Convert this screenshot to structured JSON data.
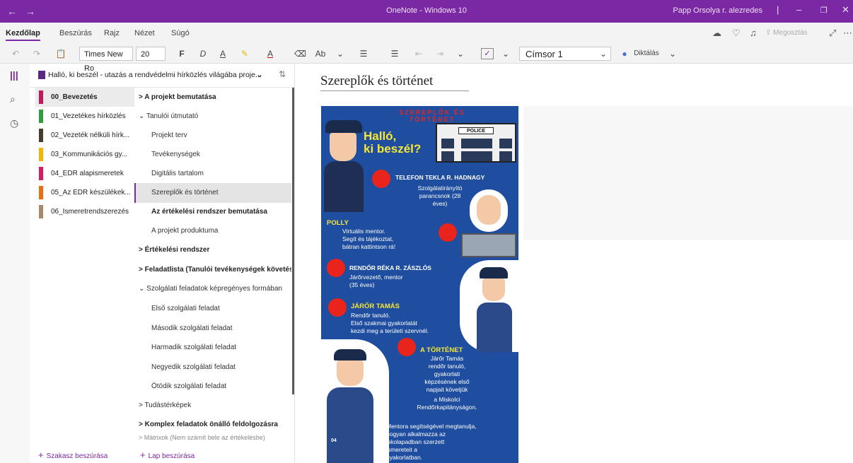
{
  "window": {
    "title": "OneNote - Windows 10",
    "user": "Papp Orsolya r. alezredes"
  },
  "menu": {
    "tabs": [
      "Kezdőlap",
      "Beszúrás",
      "Rajz",
      "Nézet",
      "Súgó"
    ],
    "share_label": "Megosztás"
  },
  "toolbar": {
    "font_name": "Times New Ro",
    "font_size": "20",
    "bold": "F",
    "italic": "D",
    "underline": "A",
    "style": "Címsor 1",
    "dictate": "Diktálás"
  },
  "notebook": {
    "title": "Halló, ki beszél - utazás a rendvédelmi hírközlés világába proje..."
  },
  "sections": [
    {
      "label": "00_Bevezetés",
      "color": "#c2185b"
    },
    {
      "label": "01_Vezetékes hírközlés",
      "color": "#2e9e3f"
    },
    {
      "label": "02_Vezeték nélküli hírk...",
      "color": "#4a3b2f"
    },
    {
      "label": "03_Kommunikációs gy...",
      "color": "#f2b600"
    },
    {
      "label": "04_EDR alapismeretek",
      "color": "#d81b60"
    },
    {
      "label": "05_Az EDR készülékek...",
      "color": "#f06a0f"
    },
    {
      "label": "06_Ismeretrendszerezés",
      "color": "#a8896b"
    }
  ],
  "pages": [
    {
      "label": "> A projekt bemutatása"
    },
    {
      "label": "⌄ Tanulói útmutató"
    },
    {
      "label": "Projekt terv"
    },
    {
      "label": "Tevékenységek"
    },
    {
      "label": "Digitális tartalom"
    },
    {
      "label": "Szereplők és történet"
    },
    {
      "label": "Az értékelési rendszer bemutatása"
    },
    {
      "label": "A projekt produktuma"
    },
    {
      "label": "> Értékelési rendszer"
    },
    {
      "label": "> Feladatlista (Tanulói tevékenységek követés..."
    },
    {
      "label": "⌄ Szolgálati feladatok képregényes formában"
    },
    {
      "label": "Első szolgálati feladat"
    },
    {
      "label": "Második szolgálati feladat"
    },
    {
      "label": "Harmadik szolgálati feladat"
    },
    {
      "label": "Negyedik szolgálati feladat"
    },
    {
      "label": "Ötödik szolgálati feladat"
    },
    {
      "label": "> Tudástérképek"
    },
    {
      "label": "> Komplex feladatok önálló feldolgozásra"
    },
    {
      "label": "> Mátrixok (Nem számít bele az értékelésbe)"
    }
  ],
  "bottom": {
    "add_section": "Szakasz beszúrása",
    "add_page": "Lap beszúrása"
  },
  "page": {
    "title": "Szereplők és történet"
  },
  "poster": {
    "header": "SZEREPLŐK ÉS TÖRTÉNET",
    "headline1": "Halló,",
    "headline2": "ki beszél?",
    "police_sign": "POLICE",
    "c1_name": "TELEFON TEKLA R. HADNAGY",
    "c1_desc": "Szolgálatirányító parancsnok (28 éves)",
    "c2_name": "POLLY",
    "c2_desc1": "Virtuális mentor.",
    "c2_desc2": "Segít és tájékoztat,",
    "c2_desc3": "bátran kattintson rá!",
    "c3_name": "RENDŐR RÉKA R. ZÁSZLÓS",
    "c3_desc1": "Járőrvezető, mentor",
    "c3_desc2": "(35 éves)",
    "c4_name": "JÁRŐR TAMÁS",
    "c4_desc1": "Rendőr tanuló.",
    "c4_desc2": "Első szakmai gyakorlatát",
    "c4_desc3": "kezdi meg a területi szervnél.",
    "story_title": "A TÖRTÉNET",
    "story1": "Járőr Tamás",
    "story2": "rendőr tanuló,",
    "story3": "gyakorlati",
    "story4": "képzésének első",
    "story5": "napjait követjük",
    "story6": "a Miskolci",
    "story7": "Rendőrkapitányságon.",
    "story8": "Mentora segítségével megtanulja,",
    "story9": "hogyan alkalmazza az",
    "story10": "iskolapadban szerzett",
    "story11": "ismereteit a",
    "story12": "gyakorlatban.",
    "badge": "04"
  }
}
